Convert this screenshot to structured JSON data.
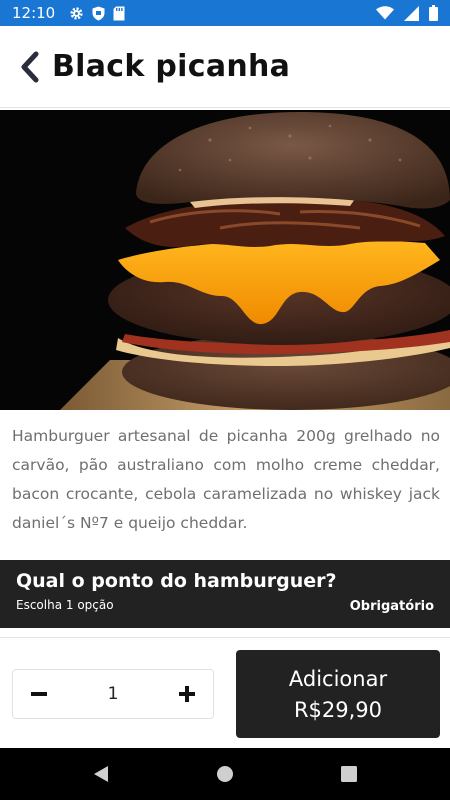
{
  "status_bar": {
    "time": "12:10",
    "left_icons": [
      "gear-icon",
      "shield-icon",
      "sd-card-icon"
    ],
    "right_icons": [
      "wifi-icon",
      "signal-icon",
      "battery-icon"
    ],
    "background_color": "#1976d2"
  },
  "header": {
    "title": "Black picanha",
    "back_icon": "chevron-left-icon"
  },
  "product": {
    "image": "burger-photo",
    "description": "Hamburguer artesanal de picanha 200g grelhado no carvão, pão australiano com molho creme cheddar, bacon crocante, cebola caramelizada no whiskey jack daniel´s Nº7 e queijo cheddar."
  },
  "question": {
    "title": "Qual o ponto do hamburguer?",
    "subtitle": "Escolha 1 opção",
    "required_label": "Obrigatório"
  },
  "quantity": {
    "value": "1",
    "decrement_icon": "minus-icon",
    "increment_icon": "plus-icon"
  },
  "add_button": {
    "label": "Adicionar",
    "price": "R$29,90",
    "background_color": "#222222"
  },
  "nav_bar": {
    "icons": [
      "back-triangle-icon",
      "home-circle-icon",
      "recents-square-icon"
    ]
  }
}
